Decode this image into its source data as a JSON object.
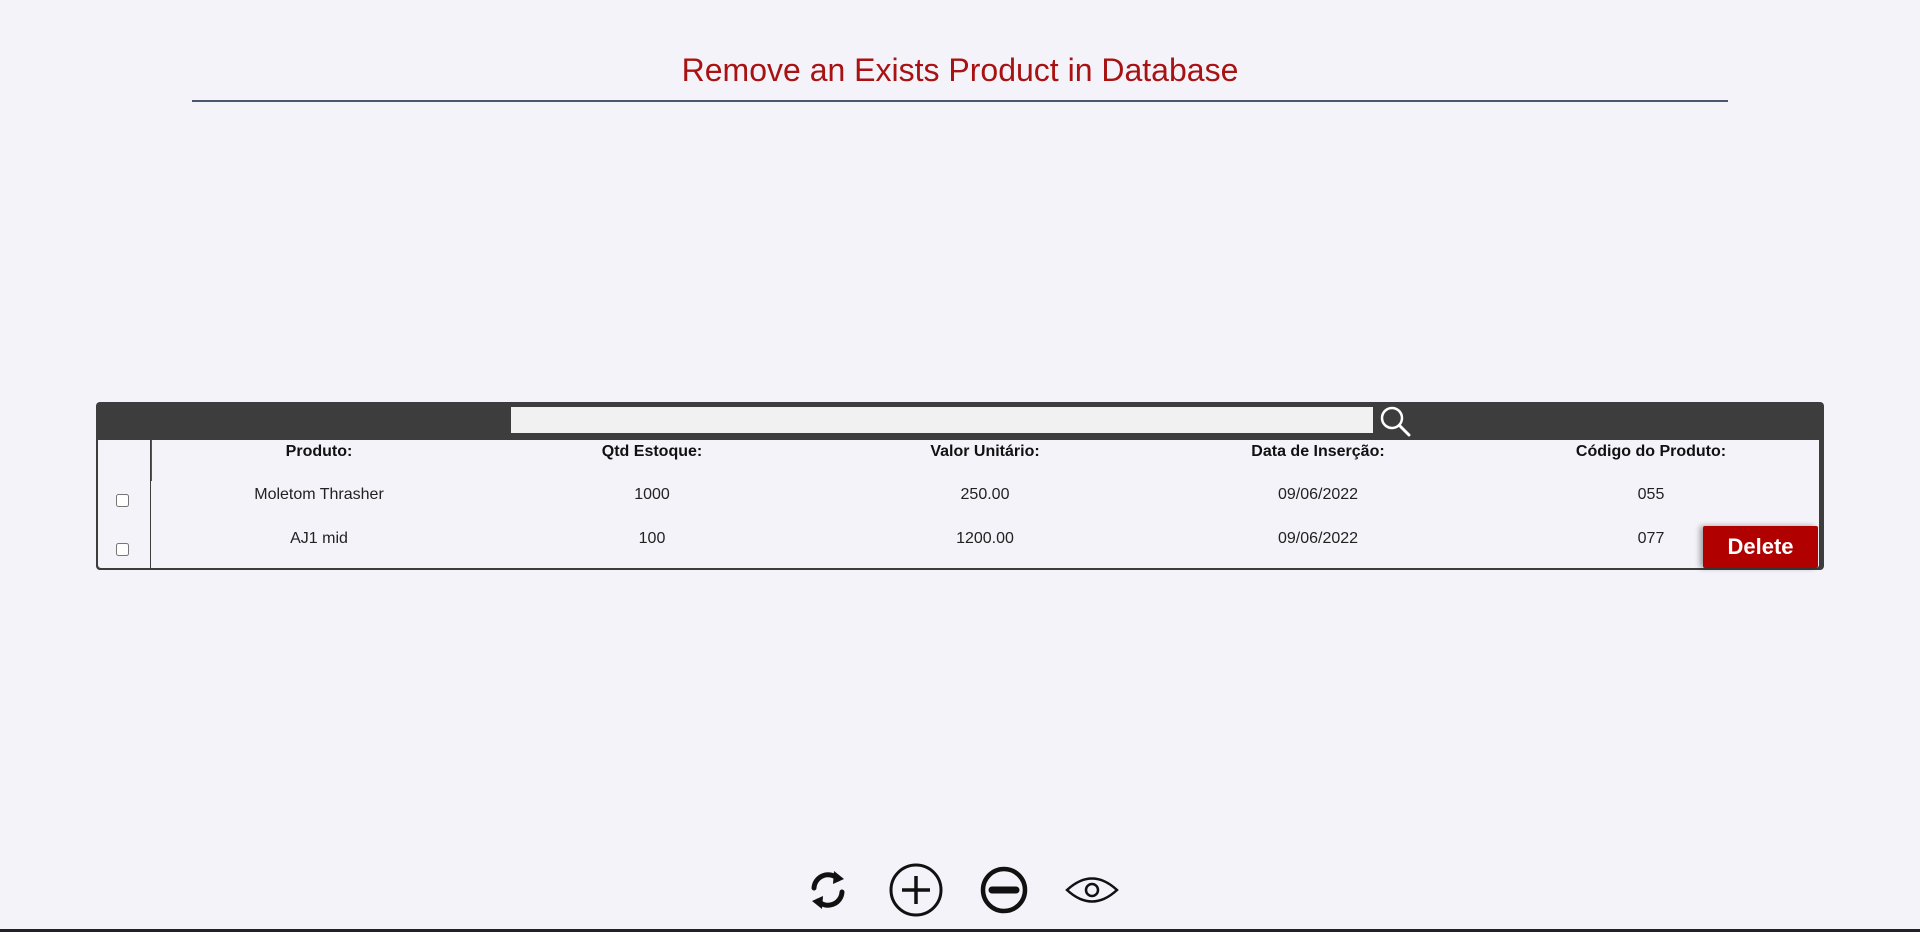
{
  "page": {
    "title": "Remove an Exists Product in Database"
  },
  "search": {
    "value": "",
    "placeholder": "",
    "icon": "search-icon"
  },
  "table": {
    "columns": [
      "Produto:",
      "Qtd Estoque:",
      "Valor Unitário:",
      "Data de Inserção:",
      "Código do Produto:"
    ],
    "rows": [
      {
        "selected": false,
        "produto": "Moletom Thrasher",
        "qtd": "1000",
        "valor": "250.00",
        "data": "09/06/2022",
        "codigo": "055"
      },
      {
        "selected": false,
        "produto": "AJ1 mid",
        "qtd": "100",
        "valor": "1200.00",
        "data": "09/06/2022",
        "codigo": "077"
      }
    ]
  },
  "actions": {
    "delete_label": "Delete"
  },
  "toolbar": {
    "icons": [
      "refresh-icon",
      "add-circle-icon",
      "remove-circle-icon",
      "eye-icon"
    ]
  },
  "colors": {
    "title": "#a81212",
    "panel": "#3d3d3d",
    "delete": "#b00000",
    "background": "#f3f3f9"
  }
}
